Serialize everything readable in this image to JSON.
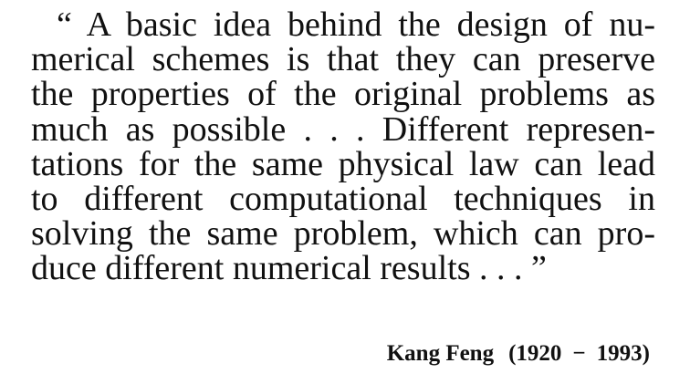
{
  "quote": {
    "lines": [
      "“ A basic idea behind the design of nu-",
      "merical schemes is that they can preserve",
      "the properties of the original problems as",
      "much as possible . . . Different represen-",
      "tations for the same physical law can lead",
      "to different computational techniques in",
      "solving the same problem, which can pro-",
      "duce different numerical results . . . ”"
    ]
  },
  "attribution": {
    "name": "Kang Feng",
    "years_open": "(1920",
    "dash": "−",
    "years_close": "1993)"
  }
}
